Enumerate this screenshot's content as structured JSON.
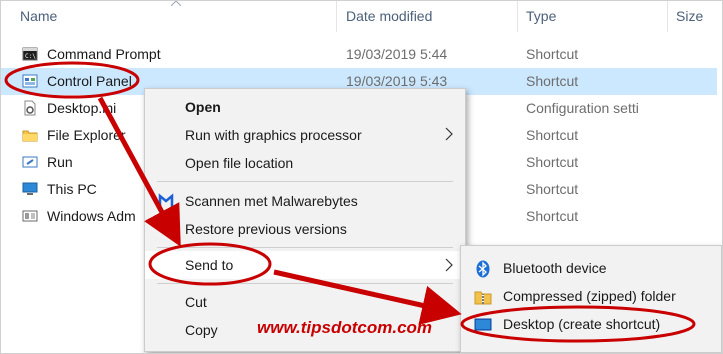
{
  "headers": {
    "name": "Name",
    "date": "Date modified",
    "type": "Type",
    "size": "Size"
  },
  "files": [
    {
      "icon": "command-prompt-icon",
      "name": "Command Prompt",
      "date": "19/03/2019 5:44",
      "type": "Shortcut",
      "selected": false
    },
    {
      "icon": "control-panel-icon",
      "name": "Control Panel",
      "date": "19/03/2019 5:43",
      "type": "Shortcut",
      "selected": true
    },
    {
      "icon": "settings-file-icon",
      "name": "Desktop.ini",
      "date": "",
      "type": "Configuration setti",
      "selected": false
    },
    {
      "icon": "file-explorer-icon",
      "name": "File Explorer",
      "date": "",
      "type": "Shortcut",
      "selected": false
    },
    {
      "icon": "run-icon",
      "name": "Run",
      "date": "",
      "type": "Shortcut",
      "selected": false
    },
    {
      "icon": "this-pc-icon",
      "name": "This PC",
      "date": "",
      "type": "Shortcut",
      "selected": false
    },
    {
      "icon": "windows-admin-icon",
      "name": "Windows Adm",
      "date": "",
      "type": "Shortcut",
      "selected": false
    }
  ],
  "context_menu": {
    "open": "Open",
    "run_gpu": "Run with graphics processor",
    "open_location": "Open file location",
    "malwarebytes": "Scannen met Malwarebytes",
    "restore": "Restore previous versions",
    "send_to": "Send to",
    "cut": "Cut",
    "copy": "Copy"
  },
  "send_to_menu": {
    "bluetooth": "Bluetooth device",
    "compressed": "Compressed (zipped) folder",
    "desktop": "Desktop (create shortcut)"
  },
  "watermark": "www.tipsdotcom.com",
  "colors": {
    "selection": "#cce8ff",
    "annotation_red": "#c80000",
    "menu_bg": "#f2f2f2"
  }
}
